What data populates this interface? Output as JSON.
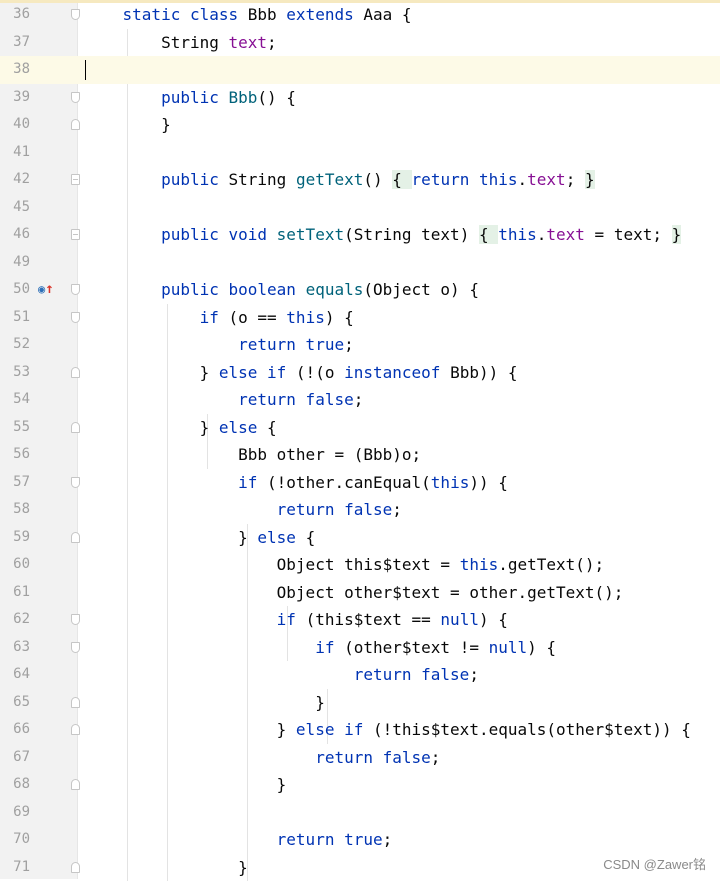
{
  "editor": {
    "lines": [
      {
        "num": "36",
        "fold": "start",
        "tokens": [
          [
            "    ",
            ""
          ],
          [
            "static class ",
            "kw"
          ],
          [
            "Bbb ",
            ""
          ],
          [
            "extends ",
            "kw"
          ],
          [
            "Aaa {",
            ""
          ]
        ]
      },
      {
        "num": "37",
        "tokens": [
          [
            "        String ",
            ""
          ],
          [
            "text",
            "fld"
          ],
          [
            ";",
            ""
          ]
        ]
      },
      {
        "num": "38",
        "current": true,
        "caret": true,
        "tokens": []
      },
      {
        "num": "39",
        "fold": "start",
        "tokens": [
          [
            "        ",
            ""
          ],
          [
            "public ",
            "kw"
          ],
          [
            "Bbb",
            "fn"
          ],
          [
            "() {",
            ""
          ]
        ]
      },
      {
        "num": "40",
        "fold": "end",
        "tokens": [
          [
            "        }",
            ""
          ]
        ]
      },
      {
        "num": "41",
        "tokens": []
      },
      {
        "num": "42",
        "fold": "box",
        "tokens": [
          [
            "        ",
            ""
          ],
          [
            "public ",
            "kw"
          ],
          [
            "String ",
            ""
          ],
          [
            "getText",
            "fn"
          ],
          [
            "() ",
            ""
          ],
          [
            "{ ",
            "hl"
          ],
          [
            "return this",
            "kw"
          ],
          [
            ".",
            ""
          ],
          [
            "text",
            "fld"
          ],
          [
            "; ",
            ""
          ],
          [
            "}",
            "hl"
          ]
        ]
      },
      {
        "num": "45",
        "tokens": []
      },
      {
        "num": "46",
        "fold": "box",
        "tokens": [
          [
            "        ",
            ""
          ],
          [
            "public void ",
            "kw"
          ],
          [
            "setText",
            "fn"
          ],
          [
            "(String text) ",
            ""
          ],
          [
            "{ ",
            "hl"
          ],
          [
            "this",
            "kw"
          ],
          [
            ".",
            ""
          ],
          [
            "text",
            "fld"
          ],
          [
            " = text; ",
            ""
          ],
          [
            "}",
            "hl"
          ]
        ]
      },
      {
        "num": "49",
        "tokens": []
      },
      {
        "num": "50",
        "fold": "start",
        "marker": true,
        "tokens": [
          [
            "        ",
            ""
          ],
          [
            "public boolean ",
            "kw"
          ],
          [
            "equals",
            "fn"
          ],
          [
            "(Object o) {",
            ""
          ]
        ]
      },
      {
        "num": "51",
        "fold": "start",
        "tokens": [
          [
            "            ",
            ""
          ],
          [
            "if ",
            "kw"
          ],
          [
            "(o == ",
            ""
          ],
          [
            "this",
            "kw"
          ],
          [
            ") {",
            ""
          ]
        ]
      },
      {
        "num": "52",
        "tokens": [
          [
            "                ",
            ""
          ],
          [
            "return true",
            "kw"
          ],
          [
            ";",
            ""
          ]
        ]
      },
      {
        "num": "53",
        "fold": "end",
        "tokens": [
          [
            "            } ",
            ""
          ],
          [
            "else if ",
            "kw"
          ],
          [
            "(!(o ",
            ""
          ],
          [
            "instanceof ",
            "kw"
          ],
          [
            "Bbb)) {",
            ""
          ]
        ]
      },
      {
        "num": "54",
        "tokens": [
          [
            "                ",
            ""
          ],
          [
            "return false",
            "kw"
          ],
          [
            ";",
            ""
          ]
        ]
      },
      {
        "num": "55",
        "fold": "end",
        "tokens": [
          [
            "            } ",
            ""
          ],
          [
            "else ",
            "kw"
          ],
          [
            "{",
            ""
          ]
        ]
      },
      {
        "num": "56",
        "tokens": [
          [
            "                Bbb other = (Bbb)o;",
            ""
          ]
        ]
      },
      {
        "num": "57",
        "fold": "start",
        "tokens": [
          [
            "                ",
            ""
          ],
          [
            "if ",
            "kw"
          ],
          [
            "(!other.canEqual(",
            ""
          ],
          [
            "this",
            "kw"
          ],
          [
            ")) {",
            ""
          ]
        ]
      },
      {
        "num": "58",
        "tokens": [
          [
            "                    ",
            ""
          ],
          [
            "return false",
            "kw"
          ],
          [
            ";",
            ""
          ]
        ]
      },
      {
        "num": "59",
        "fold": "end",
        "tokens": [
          [
            "                } ",
            ""
          ],
          [
            "else ",
            "kw"
          ],
          [
            "{",
            ""
          ]
        ]
      },
      {
        "num": "60",
        "tokens": [
          [
            "                    Object this$text = ",
            ""
          ],
          [
            "this",
            "kw"
          ],
          [
            ".getText();",
            ""
          ]
        ]
      },
      {
        "num": "61",
        "tokens": [
          [
            "                    Object other$text = other.getText();",
            ""
          ]
        ]
      },
      {
        "num": "62",
        "fold": "start",
        "tokens": [
          [
            "                    ",
            ""
          ],
          [
            "if ",
            "kw"
          ],
          [
            "(this$text == ",
            ""
          ],
          [
            "null",
            "kw"
          ],
          [
            ") {",
            ""
          ]
        ]
      },
      {
        "num": "63",
        "fold": "start",
        "tokens": [
          [
            "                        ",
            ""
          ],
          [
            "if ",
            "kw"
          ],
          [
            "(other$text != ",
            ""
          ],
          [
            "null",
            "kw"
          ],
          [
            ") {",
            ""
          ]
        ]
      },
      {
        "num": "64",
        "tokens": [
          [
            "                            ",
            ""
          ],
          [
            "return false",
            "kw"
          ],
          [
            ";",
            ""
          ]
        ]
      },
      {
        "num": "65",
        "fold": "end",
        "tokens": [
          [
            "                        }",
            ""
          ]
        ]
      },
      {
        "num": "66",
        "fold": "end",
        "tokens": [
          [
            "                    } ",
            ""
          ],
          [
            "else if ",
            "kw"
          ],
          [
            "(!this$text.equals(other$text)) {",
            ""
          ]
        ]
      },
      {
        "num": "67",
        "tokens": [
          [
            "                        ",
            ""
          ],
          [
            "return false",
            "kw"
          ],
          [
            ";",
            ""
          ]
        ]
      },
      {
        "num": "68",
        "fold": "end",
        "tokens": [
          [
            "                    }",
            ""
          ]
        ]
      },
      {
        "num": "69",
        "tokens": []
      },
      {
        "num": "70",
        "tokens": [
          [
            "                    ",
            ""
          ],
          [
            "return true",
            "kw"
          ],
          [
            ";",
            ""
          ]
        ]
      },
      {
        "num": "71",
        "fold": "end",
        "tokens": [
          [
            "                }",
            ""
          ]
        ]
      }
    ],
    "marker_icons": {
      "circle": "◉",
      "arrow": "↑"
    }
  },
  "watermark": "CSDN @Zawer铭",
  "colors": {
    "keyword": "#0033b3",
    "method": "#00627a",
    "field": "#871094",
    "current_line": "#fdfae7",
    "fold_highlight": "#e4f1e6",
    "gutter": "#f2f2f2"
  }
}
